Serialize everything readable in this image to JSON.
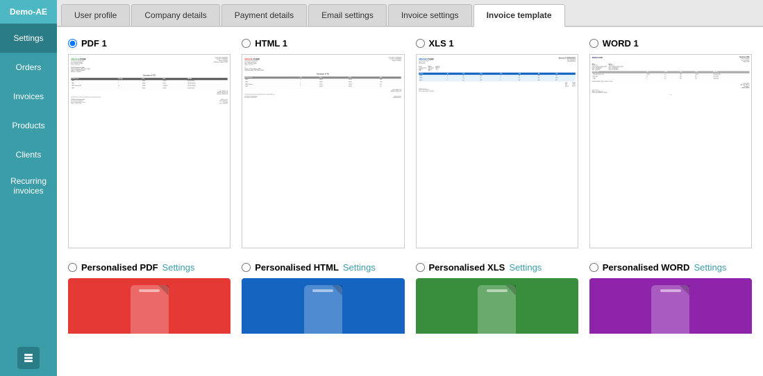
{
  "sidebar": {
    "demo_label": "Demo-AE",
    "items": [
      {
        "id": "settings",
        "label": "Settings",
        "active": true
      },
      {
        "id": "orders",
        "label": "Orders",
        "active": false
      },
      {
        "id": "invoices",
        "label": "Invoices",
        "active": false
      },
      {
        "id": "products",
        "label": "Products",
        "active": false
      },
      {
        "id": "clients",
        "label": "Clients",
        "active": false
      },
      {
        "id": "recurring",
        "label": "Recurring invoices",
        "active": false
      }
    ]
  },
  "tabs": [
    {
      "id": "user-profile",
      "label": "User profile",
      "active": false
    },
    {
      "id": "company-details",
      "label": "Company details",
      "active": false
    },
    {
      "id": "payment-details",
      "label": "Payment details",
      "active": false
    },
    {
      "id": "email-settings",
      "label": "Email settings",
      "active": false
    },
    {
      "id": "invoice-settings",
      "label": "Invoice settings",
      "active": false
    },
    {
      "id": "invoice-template",
      "label": "Invoice template",
      "active": true
    }
  ],
  "templates": [
    {
      "id": "pdf1",
      "label": "PDF 1",
      "selected": true,
      "type": "pdf"
    },
    {
      "id": "html1",
      "label": "HTML 1",
      "selected": false,
      "type": "html"
    },
    {
      "id": "xls1",
      "label": "XLS 1",
      "selected": false,
      "type": "xls"
    },
    {
      "id": "word1",
      "label": "WORD 1",
      "selected": false,
      "type": "word"
    }
  ],
  "personalised": [
    {
      "id": "pers-pdf",
      "name": "Personalised PDF",
      "settings": "Settings",
      "color": "pdf"
    },
    {
      "id": "pers-html",
      "name": "Personalised HTML",
      "settings": "Settings",
      "color": "html"
    },
    {
      "id": "pers-xls",
      "name": "Personalised XLS",
      "settings": "Settings",
      "color": "xls"
    },
    {
      "id": "pers-word",
      "name": "Personalised WORD",
      "settings": "Settings",
      "color": "word"
    }
  ]
}
